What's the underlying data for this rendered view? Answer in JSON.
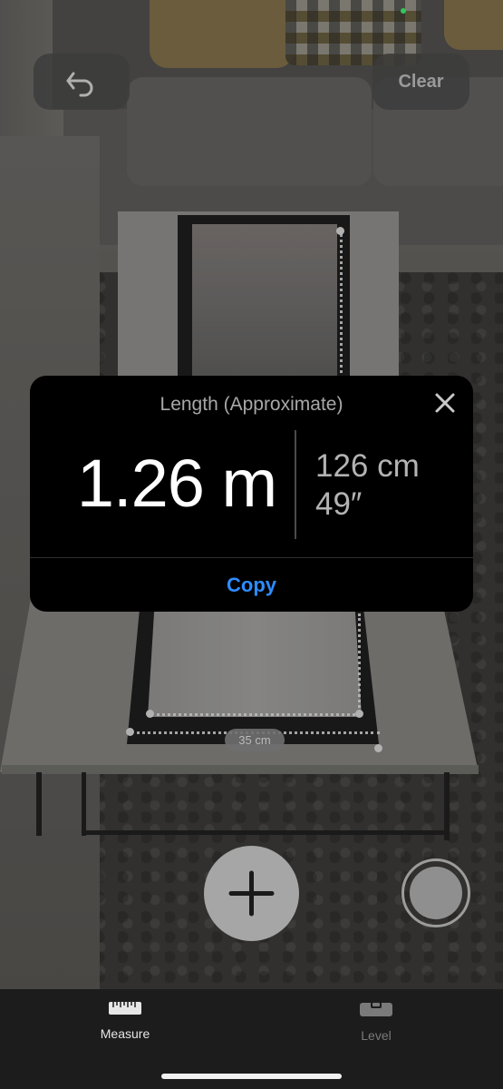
{
  "top_bar": {
    "undo_icon": "undo-arrow-icon",
    "clear_label": "Clear"
  },
  "ar_scene": {
    "segment_label": "35 cm"
  },
  "result_popup": {
    "title": "Length (Approximate)",
    "value_metric": "1.26 m",
    "value_cm": "126 cm",
    "value_inches": "49″",
    "copy_label": "Copy",
    "close_icon": "close-x-icon",
    "accent_color": "#2f8cff"
  },
  "controls": {
    "add_point_icon": "plus-icon",
    "capture_icon": "shutter-icon"
  },
  "tab_bar": {
    "tabs": [
      {
        "label": "Measure",
        "icon": "ruler-icon",
        "selected": true
      },
      {
        "label": "Level",
        "icon": "level-icon",
        "selected": false
      }
    ]
  }
}
